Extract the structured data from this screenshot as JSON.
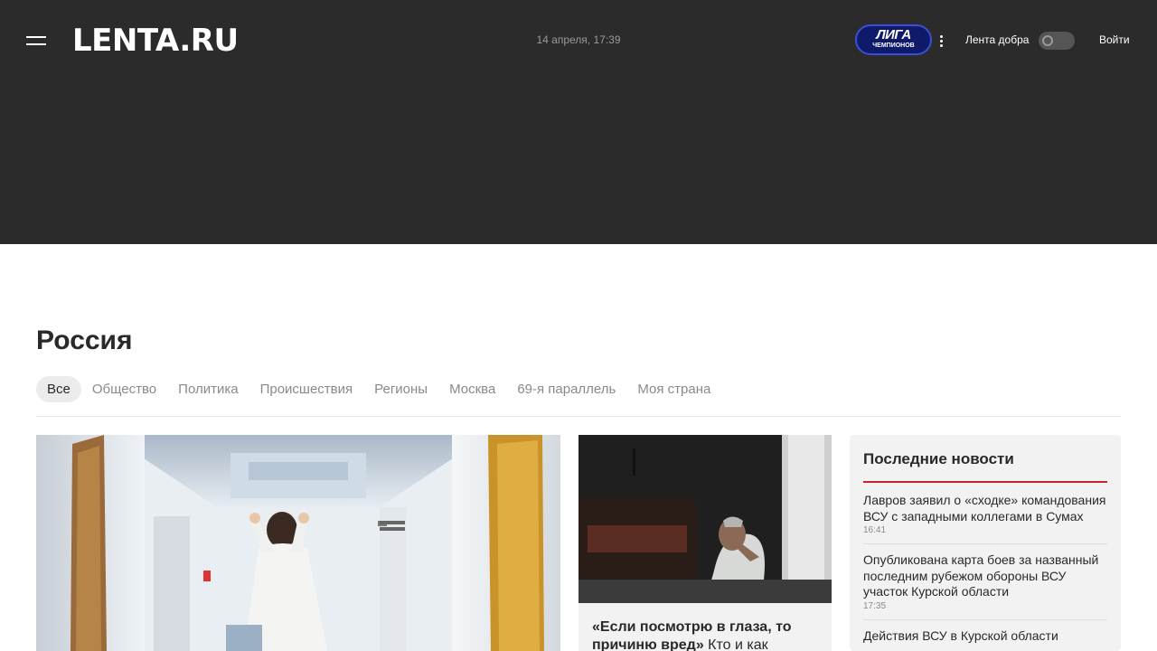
{
  "header": {
    "logo": "LENTA.RU",
    "date": "14 апреля, 17:39",
    "badge_line1": "ЛИГА",
    "badge_line2": "ЧЕМПИОНОВ",
    "kind_label": "Лента добра",
    "login": "Войти"
  },
  "section": {
    "title": "Россия",
    "tabs": [
      "Все",
      "Общество",
      "Политика",
      "Происшествия",
      "Регионы",
      "Москва",
      "69-я параллель",
      "Моя страна"
    ],
    "active_tab": 0
  },
  "card2": {
    "title_bold": "«Если посмотрю в глаза, то причиню вред»",
    "title_rest": " Кто и как"
  },
  "latest": {
    "title": "Последние новости",
    "items": [
      {
        "text": "Лавров заявил о «сходке» командования ВСУ с западными коллегами в Сумах",
        "time": "16:41"
      },
      {
        "text": "Опубликована карта боев за названный последним рубежом обороны ВСУ участок Курской области",
        "time": "17:35"
      },
      {
        "text": "Действия ВСУ в Курской области",
        "time": ""
      }
    ]
  },
  "colors": {
    "header_bg": "#2b2b2b",
    "accent_red": "#c9232d",
    "badge_blue": "#0f1a6b"
  }
}
